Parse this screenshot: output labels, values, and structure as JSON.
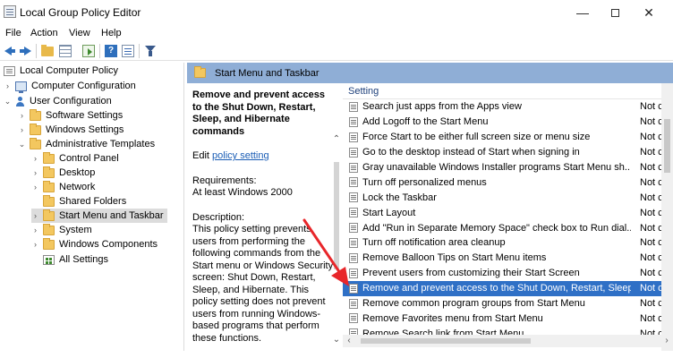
{
  "window": {
    "title": "Local Group Policy Editor",
    "minimize": "—",
    "close": "✕"
  },
  "menu": [
    "File",
    "Action",
    "View",
    "Help"
  ],
  "tree": {
    "root": "Local Computer Policy",
    "items": [
      {
        "label": "Computer Configuration",
        "expander": "›"
      },
      {
        "label": "User Configuration",
        "expander": "⌄"
      },
      {
        "label": "Software Settings",
        "expander": "›"
      },
      {
        "label": "Windows Settings",
        "expander": "›"
      },
      {
        "label": "Administrative Templates",
        "expander": "⌄"
      },
      {
        "label": "Control Panel",
        "expander": "›"
      },
      {
        "label": "Desktop",
        "expander": "›"
      },
      {
        "label": "Network",
        "expander": "›"
      },
      {
        "label": "Shared Folders",
        "expander": ""
      },
      {
        "label": "Start Menu and Taskbar",
        "expander": "›"
      },
      {
        "label": "System",
        "expander": "›"
      },
      {
        "label": "Windows Components",
        "expander": "›"
      },
      {
        "label": "All Settings",
        "expander": ""
      }
    ]
  },
  "header": {
    "title": "Start Menu and Taskbar"
  },
  "description": {
    "title": "Remove and prevent access to the Shut Down, Restart, Sleep, and Hibernate commands",
    "edit_prefix": "Edit ",
    "edit_link": "policy setting",
    "requirements_label": "Requirements:",
    "requirements_value": "At least Windows 2000",
    "description_label": "Description:",
    "description_text": "This policy setting prevents users from performing the following commands from the Start menu or Windows Security screen: Shut Down, Restart, Sleep, and Hibernate. This policy setting does not prevent users from running Windows-based programs that perform these functions."
  },
  "list": {
    "column_setting": "Setting",
    "column_state": "",
    "rows": [
      {
        "name": "Search just apps from the Apps view",
        "state": "Not c"
      },
      {
        "name": "Add Logoff to the Start Menu",
        "state": "Not c"
      },
      {
        "name": "Force Start to be either full screen size or menu size",
        "state": "Not c"
      },
      {
        "name": "Go to the desktop instead of Start when signing in",
        "state": "Not c"
      },
      {
        "name": "Gray unavailable Windows Installer programs Start Menu sh...",
        "state": "Not c"
      },
      {
        "name": "Turn off personalized menus",
        "state": "Not c"
      },
      {
        "name": "Lock the Taskbar",
        "state": "Not c"
      },
      {
        "name": "Start Layout",
        "state": "Not c"
      },
      {
        "name": "Add \"Run in Separate Memory Space\" check box to Run dial...",
        "state": "Not c"
      },
      {
        "name": "Turn off notification area cleanup",
        "state": "Not c"
      },
      {
        "name": "Remove Balloon Tips on Start Menu items",
        "state": "Not c"
      },
      {
        "name": "Prevent users from customizing their Start Screen",
        "state": "Not c"
      },
      {
        "name": "Remove and prevent access to the Shut Down, Restart, Sleep...",
        "state": "Not c"
      },
      {
        "name": "Remove common program groups from Start Menu",
        "state": "Not c"
      },
      {
        "name": "Remove Favorites menu from Start Menu",
        "state": "Not c"
      },
      {
        "name": "Remove Search link from Start Menu",
        "state": "Not c"
      }
    ]
  },
  "scroll": {
    "up": "⌃",
    "down": "⌄",
    "left": "‹",
    "right": "›"
  },
  "colors": {
    "header_bar": "#8faed6",
    "selection": "#2f70c6",
    "annotation_arrow": "#e8262a"
  }
}
